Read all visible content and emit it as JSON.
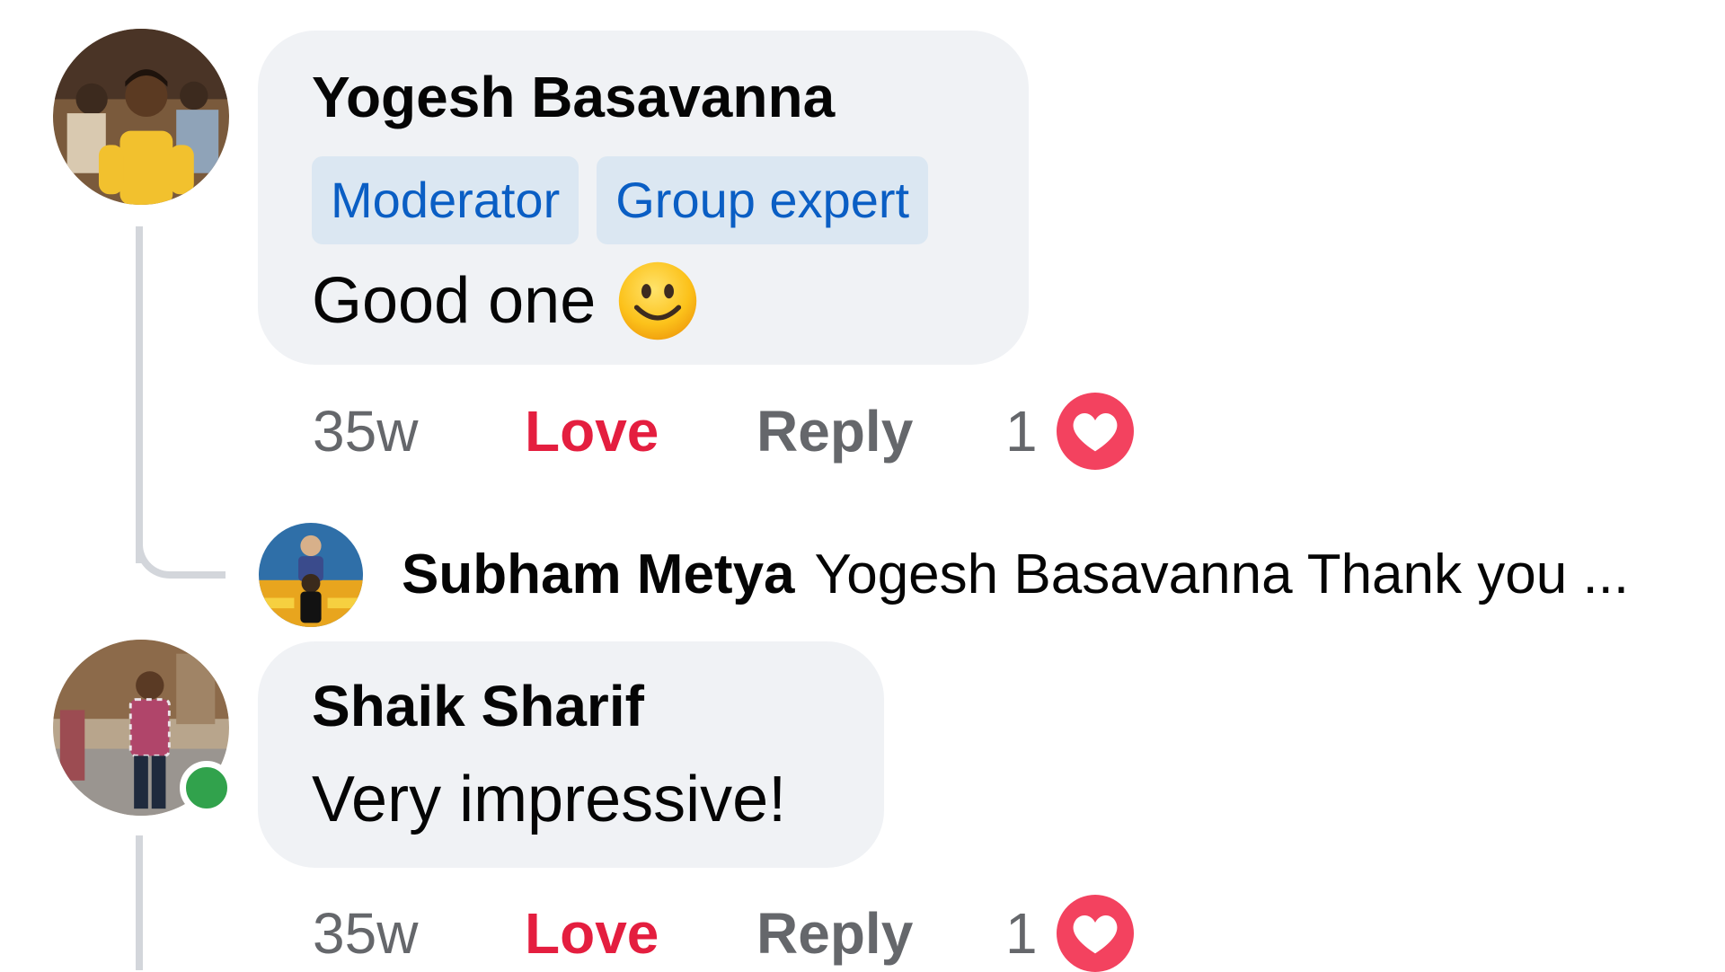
{
  "comments": [
    {
      "author": "Yogesh Basavanna",
      "badges": [
        "Moderator",
        "Group expert"
      ],
      "text": "Good one",
      "emoji": "slightly-smiling-face",
      "time": "35w",
      "love_label": "Love",
      "reply_label": "Reply",
      "reaction_count": "1",
      "reaction_icon": "heart-icon"
    },
    {
      "author": "Shaik Sharif",
      "text": "Very impressive!",
      "online": true,
      "time": "35w",
      "love_label": "Love",
      "reply_label": "Reply",
      "reaction_count": "1",
      "reaction_icon": "heart-icon"
    }
  ],
  "reply": {
    "author": "Subham Metya",
    "text": "Yogesh Basavanna Thank you ..."
  },
  "colors": {
    "bubble": "#f0f2f5",
    "love": "#e41e3f",
    "heart": "#f3425f",
    "badge_bg": "#dbe7f2",
    "badge_text": "#0a5ec4",
    "online": "#31a24c",
    "meta": "#65676b"
  }
}
